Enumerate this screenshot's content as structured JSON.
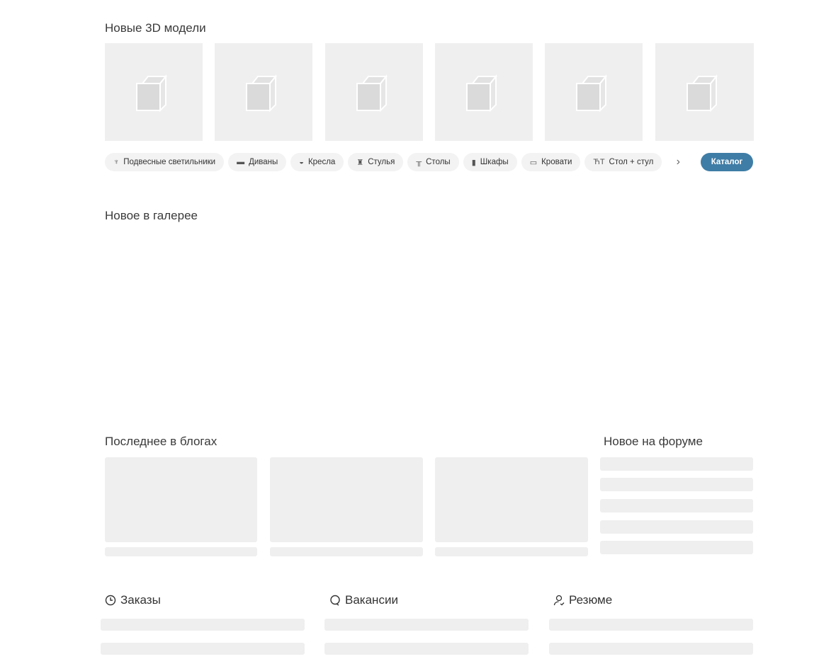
{
  "sections": {
    "new_models": "Новые 3D модели",
    "gallery": "Новое в галерее",
    "blogs": "Последнее в блогах",
    "forum": "Новое на форуме"
  },
  "categories": [
    {
      "label": "Подвесные светильники",
      "icon": "chandelier-icon"
    },
    {
      "label": "Диваны",
      "icon": "sofa-icon"
    },
    {
      "label": "Кресла",
      "icon": "armchair-icon"
    },
    {
      "label": "Стулья",
      "icon": "chair-icon"
    },
    {
      "label": "Столы",
      "icon": "table-icon"
    },
    {
      "label": "Шкафы",
      "icon": "wardrobe-icon"
    },
    {
      "label": "Кровати",
      "icon": "bed-icon"
    },
    {
      "label": "Стол + стул",
      "icon": "table-chair-icon"
    }
  ],
  "catalog_button": "Каталог",
  "bottom": {
    "orders": "Заказы",
    "vacancies": "Вакансии",
    "resume": "Резюме"
  },
  "colors": {
    "accent": "#3f7da6",
    "placeholder": "#efefef"
  }
}
